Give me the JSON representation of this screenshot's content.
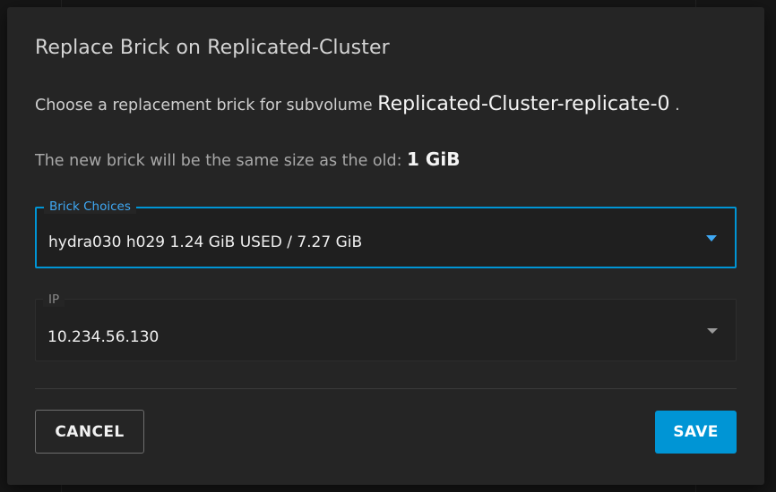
{
  "dialog": {
    "title": "Replace Brick on Replicated-Cluster",
    "subvolume_prefix": "Choose a replacement brick for subvolume ",
    "subvolume_name": "Replicated-Cluster-replicate-0",
    "subvolume_suffix": " .",
    "size_prefix": "The new brick will be the same size as the old: ",
    "size_value": "1 GiB"
  },
  "brick_field": {
    "label": "Brick Choices",
    "value": "hydra030 h029 1.24 GiB USED / 7.27 GiB",
    "icon": "chevron-down-icon",
    "accent_color": "#0095d5"
  },
  "ip_field": {
    "label": "IP",
    "value": "10.234.56.130",
    "icon": "chevron-down-icon"
  },
  "actions": {
    "cancel_label": "CANCEL",
    "save_label": "SAVE",
    "save_color": "#0095d5"
  }
}
